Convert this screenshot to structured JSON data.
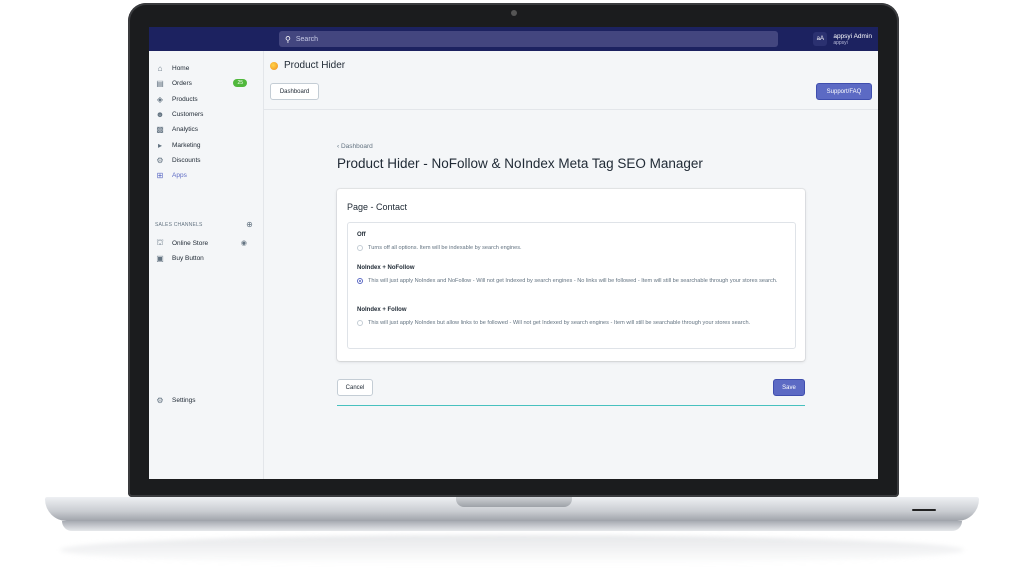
{
  "topbar": {
    "search_placeholder": "Search",
    "user_initials": "aA",
    "user_name": "appsyi Admin",
    "user_store": "appsyi"
  },
  "sidebar": {
    "items": [
      {
        "label": "Home",
        "icon": "home-icon"
      },
      {
        "label": "Orders",
        "icon": "orders-icon",
        "badge": "25"
      },
      {
        "label": "Products",
        "icon": "tag-icon"
      },
      {
        "label": "Customers",
        "icon": "person-icon"
      },
      {
        "label": "Analytics",
        "icon": "bar-chart-icon"
      },
      {
        "label": "Marketing",
        "icon": "megaphone-icon"
      },
      {
        "label": "Discounts",
        "icon": "discount-icon"
      },
      {
        "label": "Apps",
        "icon": "apps-icon"
      }
    ],
    "channels_heading": "SALES CHANNELS",
    "channels": [
      {
        "label": "Online Store",
        "icon": "store-icon"
      },
      {
        "label": "Buy Button",
        "icon": "buy-button-icon"
      }
    ],
    "settings_label": "Settings"
  },
  "header": {
    "app_title": "Product Hider",
    "dashboard_button": "Dashboard",
    "support_button": "Support/FAQ"
  },
  "page": {
    "breadcrumb": "Dashboard",
    "title": "Product Hider - NoFollow & NoIndex Meta Tag SEO Manager",
    "card_title": "Page - Contact",
    "options": [
      {
        "label": "Off",
        "desc": "Turns off all options. Item will be indexable by search engines.",
        "selected": false
      },
      {
        "label": "NoIndex + NoFollow",
        "desc": "This will just apply NoIndex and NoFollow - Will not get Indexed by search engines - No links will be followed - Item will still be searchable through your stores search.",
        "selected": true
      },
      {
        "label": "NoIndex + Follow",
        "desc": "This will just apply NoIndex but allow links to be followed - Will not get Indexed by search engines - Item will still be searchable through your stores search.",
        "selected": false
      }
    ],
    "cancel_button": "Cancel",
    "save_button": "Save"
  },
  "colors": {
    "topbar": "#1c2260",
    "accent": "#5c6ac4",
    "badge": "#50b83c"
  }
}
